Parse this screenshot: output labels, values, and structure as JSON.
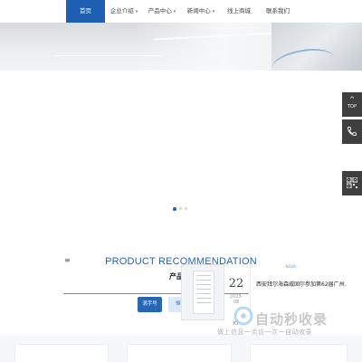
{
  "nav": {
    "items": [
      {
        "label": "首页",
        "active": true
      },
      {
        "label": "企业介绍",
        "dropdown": true
      },
      {
        "label": "产品中心",
        "dropdown": true
      },
      {
        "label": "新闻中心",
        "dropdown": true
      },
      {
        "label": "线上商城"
      },
      {
        "label": "联系我们"
      }
    ]
  },
  "carousel": {
    "slides": 3,
    "active_index": 0
  },
  "side_tools": {
    "top_label": "TOP",
    "top_arrow": "^",
    "phone_icon": "phone-icon",
    "qr_icon": "qrcode-icon"
  },
  "products": {
    "menu_icon": "≡",
    "title": "PRODUCT RECOMMENDATION",
    "subtitle": "产品",
    "categories": [
      "涡宇号",
      "恒宇"
    ]
  },
  "news": {
    "tag": "· NEWS ·",
    "day": "22",
    "year_month": "2023-08",
    "title": "西安拜尔海森威固尔参加第62届广州...",
    "extra": "ю"
  },
  "watermark": {
    "title": "自动秒收录",
    "slogan": "做上信息一点访一次一自动收录"
  },
  "colors": {
    "brand": "#1f5fb1",
    "nav_active_text": "#ffffff",
    "title": "#2464b8",
    "side_tool_bg": "#3f3f3f"
  }
}
